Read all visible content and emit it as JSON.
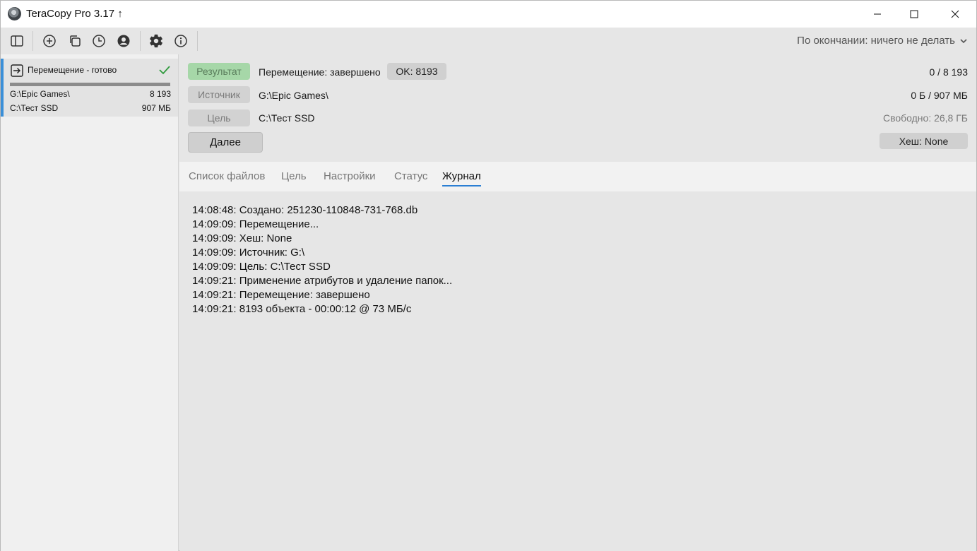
{
  "window": {
    "title": "TeraCopy Pro 3.17 ↑"
  },
  "toolbar": {
    "finish_action": "По окончании: ничего не делать"
  },
  "sidebar": {
    "job": {
      "title": "Перемещение - готово",
      "source_path": "G:\\Epic Games\\",
      "source_count": "8 193",
      "target_path": "C:\\Тест SSD",
      "target_size": "907 МБ",
      "progress": 1.0
    }
  },
  "details": {
    "result_label": "Результат",
    "result_value": "Перемещение: завершено",
    "ok_badge": "OK: 8193",
    "count": "0 / 8 193",
    "source_label": "Источник",
    "source_value": "G:\\Epic Games\\",
    "size": "0 Б / 907 МБ",
    "target_label": "Цель",
    "target_value": "C:\\Тест SSD",
    "free_space": "Свободно: 26,8 ГБ",
    "next_button": "Далее",
    "hash_badge": "Хеш: None"
  },
  "tabs": [
    {
      "label": "Список файлов",
      "active": false
    },
    {
      "label": "Цель",
      "active": false
    },
    {
      "label": "Настройки",
      "active": false
    },
    {
      "label": "Статус",
      "active": false
    },
    {
      "label": "Журнал",
      "active": true
    }
  ],
  "log": [
    "14:08:48: Создано: 251230-110848-731-768.db",
    "14:09:09: Перемещение...",
    "14:09:09: Хеш: None",
    "14:09:09: Источник: G:\\",
    "14:09:09: Цель: C:\\Тест SSD",
    "14:09:21: Применение атрибутов и удаление папок...",
    "14:09:21: Перемещение: завершено",
    "14:09:21: 8193 объекта - 00:00:12 @ 73 МБ/с"
  ],
  "colors": {
    "accent": "#2b7fd4",
    "success": "#2e9a3c",
    "result_pill": "#a6d7a8"
  }
}
